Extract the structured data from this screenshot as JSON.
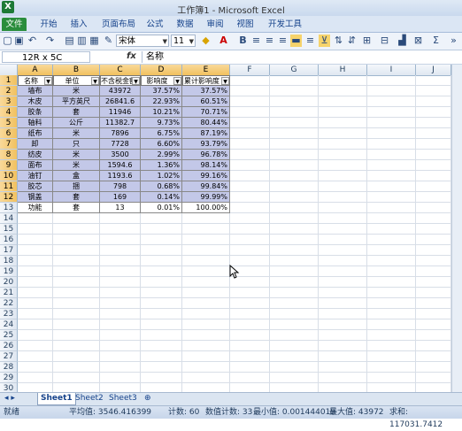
{
  "window": {
    "title": "工作簿1 - Microsoft Excel",
    "app_icon": "X"
  },
  "ribbon_tabs": [
    {
      "label": "文件"
    },
    {
      "label": "开始"
    },
    {
      "label": "插入"
    },
    {
      "label": "页面布局"
    },
    {
      "label": "公式"
    },
    {
      "label": "数据"
    },
    {
      "label": "审阅"
    },
    {
      "label": "视图"
    },
    {
      "label": "开发工具"
    }
  ],
  "toolbar": {
    "font_name": "宋体",
    "font_size": "11"
  },
  "formula_bar": {
    "name_box": "12R x 5C",
    "fx": "fx",
    "formula": "名称"
  },
  "columns": [
    "A",
    "B",
    "C",
    "D",
    "E",
    "F",
    "G",
    "H",
    "I",
    "J"
  ],
  "rows": [
    "1",
    "2",
    "3",
    "4",
    "5",
    "6",
    "7",
    "8",
    "9",
    "10",
    "11",
    "12",
    "13",
    "14",
    "15",
    "16",
    "17",
    "18",
    "19",
    "20",
    "21",
    "22",
    "23",
    "24",
    "25",
    "26",
    "27",
    "28",
    "29",
    "30"
  ],
  "table": {
    "headers": [
      "名称",
      "单位",
      "不含税金额",
      "影响度",
      "累计影响度"
    ],
    "rows": [
      [
        "墙布",
        "米",
        "43972",
        "37.57%",
        "37.57%"
      ],
      [
        "木皮",
        "平方英尺",
        "26841.6",
        "22.93%",
        "60.51%"
      ],
      [
        "胶条",
        "套",
        "11946",
        "10.21%",
        "70.71%"
      ],
      [
        "轴料",
        "公斤",
        "11382.7",
        "9.73%",
        "80.44%"
      ],
      [
        "纸布",
        "米",
        "7896",
        "6.75%",
        "87.19%"
      ],
      [
        "卸",
        "只",
        "7728",
        "6.60%",
        "93.79%"
      ],
      [
        "纺皮",
        "米",
        "3500",
        "2.99%",
        "96.78%"
      ],
      [
        "面布",
        "米",
        "1594.6",
        "1.36%",
        "98.14%"
      ],
      [
        "油钉",
        "盒",
        "1193.6",
        "1.02%",
        "99.16%"
      ],
      [
        "胶芯",
        "捆",
        "798",
        "0.68%",
        "99.84%"
      ],
      [
        "钢盖",
        "套",
        "169",
        "0.14%",
        "99.99%"
      ],
      [
        "功能",
        "套",
        "13",
        "0.01%",
        "100.00%"
      ]
    ]
  },
  "sheets": [
    "Sheet1",
    "Sheet2",
    "Sheet3"
  ],
  "status": {
    "mode": "就绪",
    "average": "平均值: 3546.416399",
    "count": "计数: 60",
    "numeric_count": "数值计数: 33",
    "min": "最小值: 0.001444019",
    "max": "最大值: 43972",
    "sum": "求和: 117031.7412"
  },
  "colors": {
    "selection": "#c3c8e8",
    "header_highlight": "#f1c15f",
    "file_tab": "#2a8d3c"
  }
}
